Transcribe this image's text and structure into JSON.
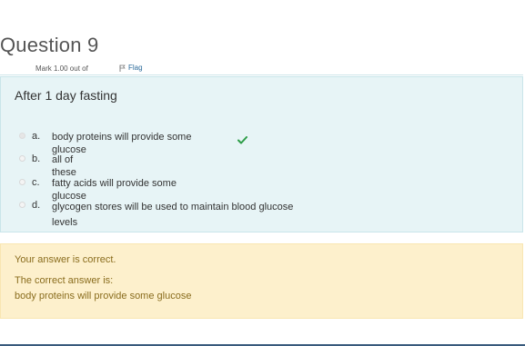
{
  "question": {
    "title": "Question 9",
    "mark": "Mark 1.00 out of",
    "flag_label": "Flag",
    "text": "After 1 day fasting",
    "options": [
      {
        "letter": "a.",
        "text": "body proteins will provide some glucose",
        "selected": true,
        "correct": true
      },
      {
        "letter": "b.",
        "text": "all of these",
        "selected": false
      },
      {
        "letter": "c.",
        "text": "fatty acids will provide some glucose",
        "selected": false
      },
      {
        "letter": "d.",
        "text": "glycogen stores will be used to maintain blood glucose levels",
        "selected": false
      }
    ]
  },
  "feedback": {
    "status": "Your answer is correct.",
    "correct_label": "The correct answer is:",
    "correct_answer": "body proteins will provide some glucose"
  },
  "colors": {
    "question_bg": "#e7f4f6",
    "feedback_bg": "#fdf0cc",
    "feedback_text": "#8a6d1e",
    "check": "#2e9d48"
  },
  "icons": {
    "flag": "flag-icon",
    "correct": "checkmark-icon"
  }
}
